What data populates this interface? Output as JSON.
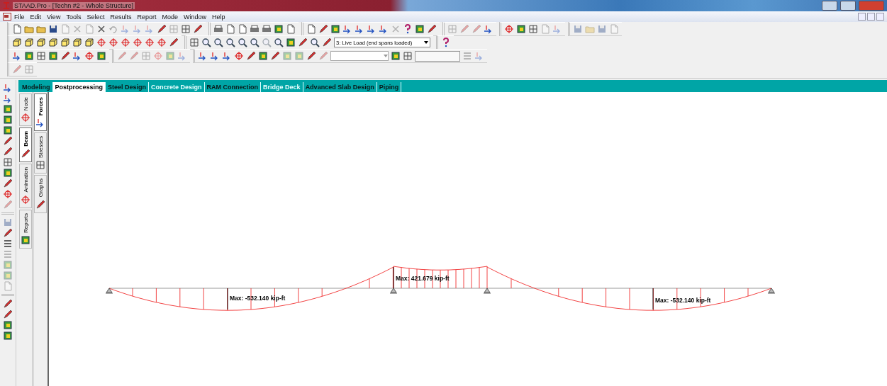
{
  "window": {
    "title": "STAAD.Pro - [Techn #2 - Whole Structure]"
  },
  "menu": {
    "items": [
      "File",
      "Edit",
      "View",
      "Tools",
      "Select",
      "Results",
      "Report",
      "Mode",
      "Window",
      "Help"
    ]
  },
  "load_case": {
    "value": "3: Live Load (end spans loaded)"
  },
  "mode_tabs": [
    {
      "label": "Modeling",
      "selected": false
    },
    {
      "label": "Postprocessing",
      "selected": true
    },
    {
      "label": "Steel Design",
      "selected": false
    },
    {
      "label": "Concrete Design",
      "selected": false
    },
    {
      "label": "RAM Connection",
      "selected": false
    },
    {
      "label": "Bridge Deck",
      "selected": false
    },
    {
      "label": "Advanced Slab Design",
      "selected": false
    },
    {
      "label": "Piping",
      "selected": false
    }
  ],
  "page_tabs": [
    {
      "label": "Node",
      "selected": false
    },
    {
      "label": "Beam",
      "selected": true
    },
    {
      "label": "Animation",
      "selected": false
    },
    {
      "label": "Reports",
      "selected": false
    }
  ],
  "sub_tabs": [
    {
      "label": "Forces",
      "selected": true
    },
    {
      "label": "Stresses",
      "selected": false
    },
    {
      "label": "Graphs",
      "selected": false
    }
  ],
  "diagram": {
    "labels": [
      "Max: -532.140 kip-ft",
      "Max: 421.679 kip-ft",
      "Max: -532.140 kip-ft"
    ]
  }
}
